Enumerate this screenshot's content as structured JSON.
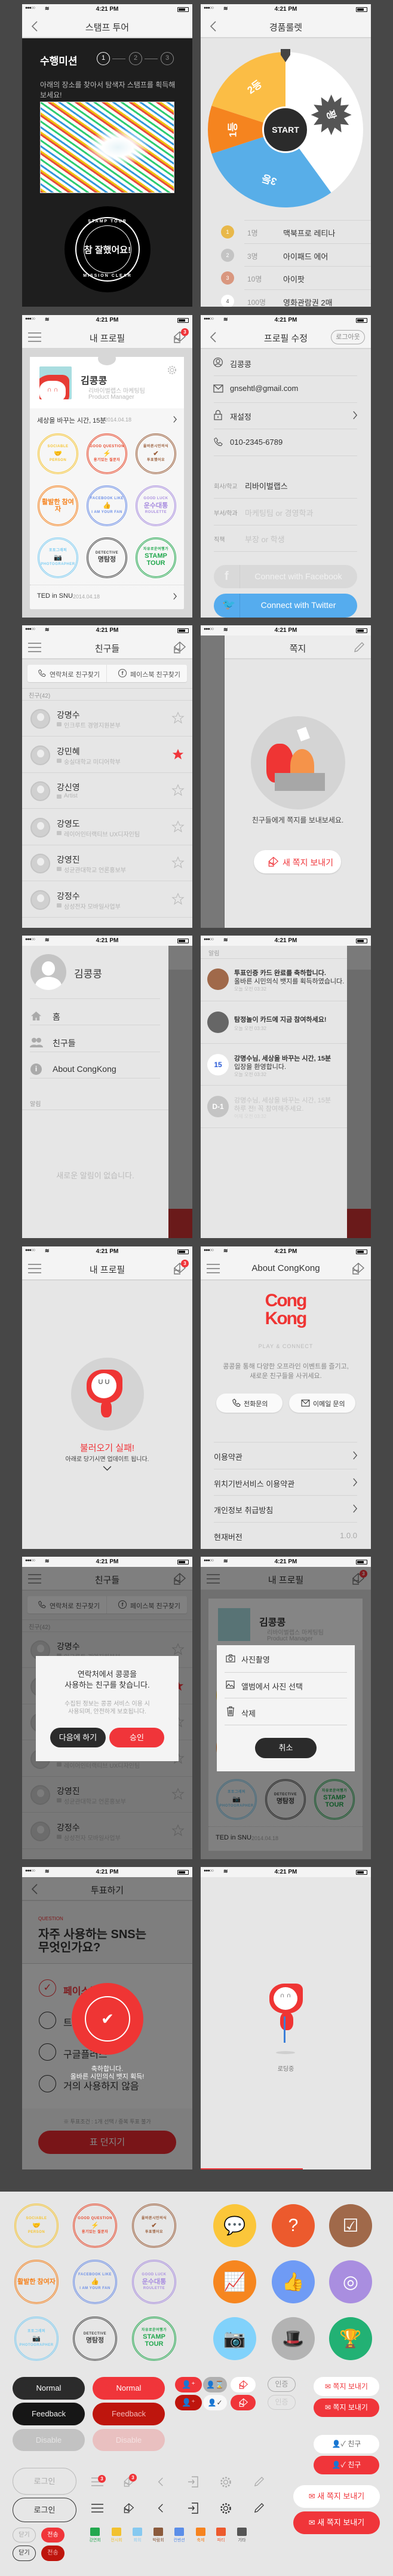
{
  "status": {
    "signal": "●●●○○",
    "wifi": "≋",
    "time": "4:21 PM"
  },
  "colors": {
    "accent": "#f0353a",
    "dark": "#2b2b2b",
    "twitter": "#55acee",
    "background": "#474747"
  },
  "stamp_tour": {
    "title": "스탬프 투어",
    "mission_label": "수행미션",
    "steps": [
      "1",
      "2",
      "3"
    ],
    "description": "아래의 장소를 찾아서 탐색자 스탬프를 획득해 보세요!",
    "stamp": {
      "top": "STAMP TOUR",
      "center": "참 잘했어요!",
      "bottom": "MISSION CLEAR"
    }
  },
  "roulette": {
    "title": "경품룰렛",
    "start": "START",
    "segments": [
      {
        "label": "꽝",
        "color": "#ffffff",
        "span_deg": 144
      },
      {
        "label": "3등",
        "color": "#58aee8",
        "span_deg": 108
      },
      {
        "label": "1등",
        "color": "#f5841f",
        "span_deg": 36
      },
      {
        "label": "2등",
        "color": "#fbbd45",
        "span_deg": 72
      }
    ],
    "prizes": [
      {
        "rank": "1",
        "count": "1명",
        "name": "맥북프로 레티나",
        "color": "#e8b84a"
      },
      {
        "rank": "2",
        "count": "3명",
        "name": "아이패드 에어",
        "color": "#c4c4c4"
      },
      {
        "rank": "3",
        "count": "10명",
        "name": "아이팟",
        "color": "#d9977f"
      },
      {
        "rank": "4",
        "count": "100명",
        "name": "영화관람권 2매",
        "color": "#ffffff"
      }
    ]
  },
  "profile": {
    "title": "내 프로필",
    "notification_count": "3",
    "name": "김콩콩",
    "org": "리바이벌랩스 마케팅팀",
    "role": "Product Manager",
    "events": [
      {
        "name": "세상을 바꾸는 시간, 15분",
        "date": "2014.04.18"
      },
      {
        "name": "TED in SNU",
        "date": "2014.04.18"
      }
    ]
  },
  "badges": [
    {
      "top": "SOCIABLE",
      "center": "🤝",
      "bottom": "PERSON",
      "color": "#f7c531"
    },
    {
      "top": "GOOD QUESTION",
      "center": "⚡",
      "bottom": "용기있는 질문자",
      "color": "#e9492c"
    },
    {
      "top": "올바른시민의식",
      "center": "✔",
      "bottom": "투표했어요",
      "color": "#9b5e3a"
    },
    {
      "top": "",
      "center": "활발한 참여자",
      "bottom": "",
      "color": "#f6831f"
    },
    {
      "top": "FACEBOOK LIKE",
      "center": "👍",
      "bottom": "I AM YOUR FAN",
      "color": "#6b8ee8"
    },
    {
      "top": "GOOD LUCK",
      "center": "운수대통",
      "bottom": "ROULETTE",
      "color": "#a98ee0"
    },
    {
      "top": "포토그래퍼",
      "center": "📷",
      "bottom": "PHOTOGRAPHER",
      "color": "#7dcdf3"
    },
    {
      "top": "DETECTIVE",
      "center": "명탐정",
      "bottom": "",
      "color": "#444444"
    },
    {
      "top": "자유로운여행가",
      "center": "STAMP TOUR",
      "bottom": "",
      "color": "#22a84e"
    }
  ],
  "profile_edit": {
    "title": "프로필 수정",
    "logout": "로그아웃",
    "name": "김콩콩",
    "email": "gnsehtl@gmail.com",
    "password": "재설정",
    "phone": "010-2345-6789",
    "fields": [
      {
        "label": "회사/학교",
        "value": "리바이벌랩스"
      },
      {
        "label": "부서/학과",
        "placeholder": "마케팅팀 or 경영학과"
      },
      {
        "label": "직책",
        "placeholder": "부장 or 학생"
      }
    ],
    "facebook": "Connect with Facebook",
    "twitter": "Connect with Twitter"
  },
  "friends": {
    "title": "친구들",
    "find_contacts": "연락처로 친구찾기",
    "find_facebook": "페이스북 친구찾기",
    "section": "친구(42)",
    "list": [
      {
        "name": "강명수",
        "sub": "인크루트 경영지원본부",
        "kind": "work",
        "starred": false
      },
      {
        "name": "강민혜",
        "sub": "숭실대학교 미디어학부",
        "kind": "work",
        "starred": true
      },
      {
        "name": "강신영",
        "sub": "Artist",
        "kind": "school",
        "starred": false
      },
      {
        "name": "강영도",
        "sub": "레이어인터랙티브 UX디자인팀",
        "kind": "work",
        "starred": false
      },
      {
        "name": "강영진",
        "sub": "성균관대학교 언론홍보부",
        "kind": "school",
        "starred": false
      },
      {
        "name": "강정수",
        "sub": "삼성전자 모바일사업부",
        "kind": "work",
        "starred": false
      }
    ]
  },
  "messages": {
    "title": "쪽지",
    "empty": "친구들에게 쪽지를 보내보세요.",
    "new_button": "새 쪽지 보내기"
  },
  "drawer": {
    "name": "김콩콩",
    "menu": [
      {
        "label": "홈",
        "icon": "home-icon"
      },
      {
        "label": "친구들",
        "icon": "friends-icon"
      },
      {
        "label": "About CongKong",
        "icon": "info-icon"
      }
    ],
    "notice_label": "알림",
    "empty": "새로운 알림이 없습니다."
  },
  "notifications": {
    "label": "알림",
    "items": [
      {
        "lines": [
          "투표인증 카드 완료를 축하합니다.",
          "올바른 시민의식 뱃지를 획득하였습니다."
        ],
        "time": "오늘 오전 03:32",
        "icon": "vote-badge",
        "read": false
      },
      {
        "lines": [
          "탐정놀이 카드에 지금 참여하세요!"
        ],
        "time": "오늘 오전 03:32",
        "icon": "detective",
        "read": false
      },
      {
        "lines": [
          "강명수님, 세상을 바꾸는 시간, 15분",
          "입장을 환영합니다."
        ],
        "time": "오늘 오전 03:32",
        "icon": "15",
        "read": false
      },
      {
        "lines": [
          "강명수님, 세상을 바꾸는 시간, 15분",
          "하루 전! 꼭 참여해주세요."
        ],
        "time": "어제 오전 03:32",
        "icon": "D-1",
        "read": true
      }
    ]
  },
  "load_fail": {
    "title": "불러오기 실패!",
    "sub": "아래로 당기시면 업데이트 됩니다."
  },
  "about": {
    "title": "About CongKong",
    "logo": "Cong Kong",
    "tagline": "PLAY & CONNECT",
    "desc": [
      "콩콩을 통해 다양한 오프라인 이벤트를 즐기고,",
      "새로운 친구들을 사귀세요."
    ],
    "phone_btn": "전화문의",
    "email_btn": "이메일 문의",
    "links": [
      "이용약관",
      "위치기반서비스 이용약관",
      "개인정보 취급방침"
    ],
    "version_label": "현재버전",
    "version": "1.0.0"
  },
  "contact_dialog": {
    "title": [
      "연락처에서 콩콩을",
      "사용하는 친구를 찾습니다."
    ],
    "sub": [
      "수집된 정보는 콩콩 서비스 이용 시",
      "사용되며, 안전하게 보호됩니다."
    ],
    "later": "다음에 하기",
    "approve": "승인"
  },
  "photo_sheet": {
    "items": [
      "사진촬영",
      "앨범에서 사진 선택",
      "삭제"
    ],
    "cancel": "취소"
  },
  "vote": {
    "title": "투표하기",
    "label": "QUESTION",
    "question": [
      "자주 사용하는 SNS는",
      "무엇인가요?"
    ],
    "options": [
      {
        "label": "페이스북",
        "checked": true
      },
      {
        "label": "트위터",
        "checked": false
      },
      {
        "label": "구글플러스",
        "checked": false
      },
      {
        "label": "거의 사용하지 않음",
        "checked": false
      }
    ],
    "note": "※ 투표조건 : 1개 선택 / 중복 투표 불가",
    "submit": "표 던지기",
    "congrats": [
      "축하합니다.",
      "올바른 시민의식 뱃지 획득!"
    ]
  },
  "loading": {
    "text": "로딩중",
    "progress": 0.6
  },
  "kit": {
    "normal": "Normal",
    "feedback": "Feedback",
    "disable": "Disable",
    "certify": "인증",
    "send_message": "쪽지 보내기",
    "friend": "친구",
    "login": "로그인",
    "close": "닫기",
    "send": "전송",
    "new_message": "새 쪽지 보내기",
    "menu_count": "3",
    "message_count": "3",
    "circle_icons": [
      {
        "icon": "chat-bubbles-icon",
        "color": "#fbc63a"
      },
      {
        "icon": "question-head-icon",
        "color": "#ec5a2d"
      },
      {
        "icon": "ballot-box-icon",
        "color": "#a0694a"
      },
      {
        "icon": "report-icon",
        "color": "#f6861f"
      },
      {
        "icon": "thumbs-up-icon",
        "color": "#6f9bf5"
      },
      {
        "icon": "dartboard-icon",
        "color": "#a98ee0"
      },
      {
        "icon": "instant-camera-icon",
        "color": "#81d2fb"
      },
      {
        "icon": "detective-icon",
        "color": "#b3b3b3"
      },
      {
        "icon": "stamp-icon",
        "color": "#22b174"
      }
    ],
    "categories": [
      {
        "label": "강연회",
        "color": "#22a84e"
      },
      {
        "label": "전시회",
        "color": "#f2c12e"
      },
      {
        "label": "회의",
        "color": "#86c9f0"
      },
      {
        "label": "박람회",
        "color": "#8b5a3c"
      },
      {
        "label": "컨벤션",
        "color": "#5b8ee8"
      },
      {
        "label": "축제",
        "color": "#f6831f"
      },
      {
        "label": "파티",
        "color": "#ec5a2d"
      },
      {
        "label": "기타",
        "color": "#555555"
      }
    ]
  }
}
